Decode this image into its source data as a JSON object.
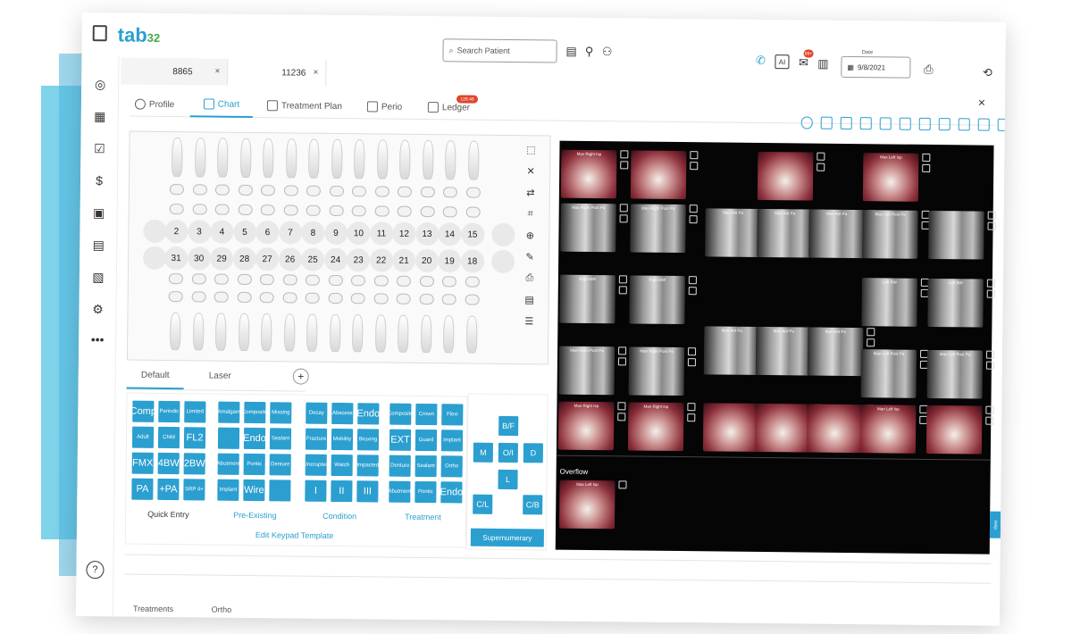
{
  "app": {
    "logo_text": "tab",
    "logo_suffix": "32",
    "accent_color": "#2b9fd0"
  },
  "topbar": {
    "search_placeholder": "Search Patient",
    "date_label": "Date",
    "date_value": "9/8/2021",
    "icons": [
      "panel-toggle-icon",
      "notes-icon",
      "add-user-icon",
      "find-user-icon",
      "phone-icon",
      "ai-icon",
      "messages-icon",
      "clipboard-icon",
      "calendar-icon",
      "print-icon",
      "sync-icon"
    ],
    "badge_messages": "99+"
  },
  "sidebar": {
    "icons": [
      "dashboard-icon",
      "calendar-icon",
      "chart-icon",
      "billing-icon",
      "insurance-icon",
      "documents-icon",
      "reports-icon",
      "settings-icon",
      "more-icon",
      "help-icon"
    ],
    "more_label": "•••",
    "help_label": "?"
  },
  "patient_tabs": [
    {
      "label": "8865",
      "close": "×"
    },
    {
      "label": "11236",
      "close": "×"
    }
  ],
  "nav_tabs": [
    {
      "label": "Profile",
      "active": false
    },
    {
      "label": "Chart",
      "active": true
    },
    {
      "label": "Treatment Plan",
      "active": false
    },
    {
      "label": "Perio",
      "active": false
    },
    {
      "label": "Ledger",
      "active": false,
      "badge": "128.46"
    }
  ],
  "close_label": "×",
  "teeth_upper": [
    "2",
    "3",
    "4",
    "5",
    "6",
    "7",
    "8",
    "9",
    "10",
    "11",
    "12",
    "13",
    "14",
    "15"
  ],
  "teeth_lower": [
    "31",
    "30",
    "29",
    "28",
    "27",
    "26",
    "25",
    "24",
    "23",
    "22",
    "21",
    "20",
    "19",
    "18"
  ],
  "chart_tools": [
    "select-icon",
    "close-icon",
    "swap-icon",
    "crop-icon",
    "zoom-icon",
    "brush-icon",
    "print-icon",
    "note-icon",
    "checklist-icon"
  ],
  "xray_labels": {
    "max_right_isp": "Max Right Isp",
    "max_right_post_pa": "Max Right Post Pa",
    "max_ant_pa": "Max Ant Pa",
    "max_left_isp": "Max Left Isp",
    "max_left_post_pa": "Max Left Post Pa",
    "right_bw": "Right BW",
    "left_bw": "Left BW",
    "man_ant_pa": "Man Ant Pa",
    "man_right_post_pa": "Man Right Post Pa",
    "man_left_post_pa": "Man Left Post Pa",
    "man_right_isp": "Man Right Isp",
    "man_left_isp": "Man Left Isp",
    "overflow": "Overflow"
  },
  "keypad_tabs": {
    "default": "Default",
    "laser": "Laser",
    "add": "+"
  },
  "keypad": {
    "quick_entry": [
      "Comp",
      "Periodic",
      "Limited",
      "Adult",
      "Child",
      "FL2",
      "FMX",
      "4BW",
      "2BW",
      "PA",
      "+PA",
      "SRP 4+"
    ],
    "pre_existing": [
      "Amalgam",
      "Composite",
      "Missing",
      "",
      "Endo",
      "Sealant",
      "Abutment",
      "Pontic",
      "Denture",
      "Implant",
      "Wire",
      ""
    ],
    "condition": [
      "Decay",
      "Abscess",
      "Endo",
      "Fracture",
      "Mobility",
      "Bruxing",
      "Unerupted",
      "Watch",
      "Impacted",
      "I",
      "II",
      "III"
    ],
    "treatment": [
      "Composite",
      "Crown",
      "Flexi",
      "EXT",
      "Guard",
      "Implant",
      "Denture",
      "Sealant",
      "Ortho",
      "Abutment",
      "Pontic",
      "Endo"
    ],
    "group_labels": {
      "quick": "Quick Entry",
      "pre": "Pre-Existing",
      "cond": "Condition",
      "treat": "Treatment"
    },
    "edit_template": "Edit Keypad Template"
  },
  "surfaces": {
    "bf": "B/F",
    "m": "M",
    "oi": "O/I",
    "d": "D",
    "l": "L",
    "cl": "C/L",
    "cb": "C/B",
    "supernumerary": "Supernumerary"
  },
  "bottom_tabs": {
    "treatments": "Treatments",
    "ortho": "Ortho"
  },
  "help_tab": "Help"
}
